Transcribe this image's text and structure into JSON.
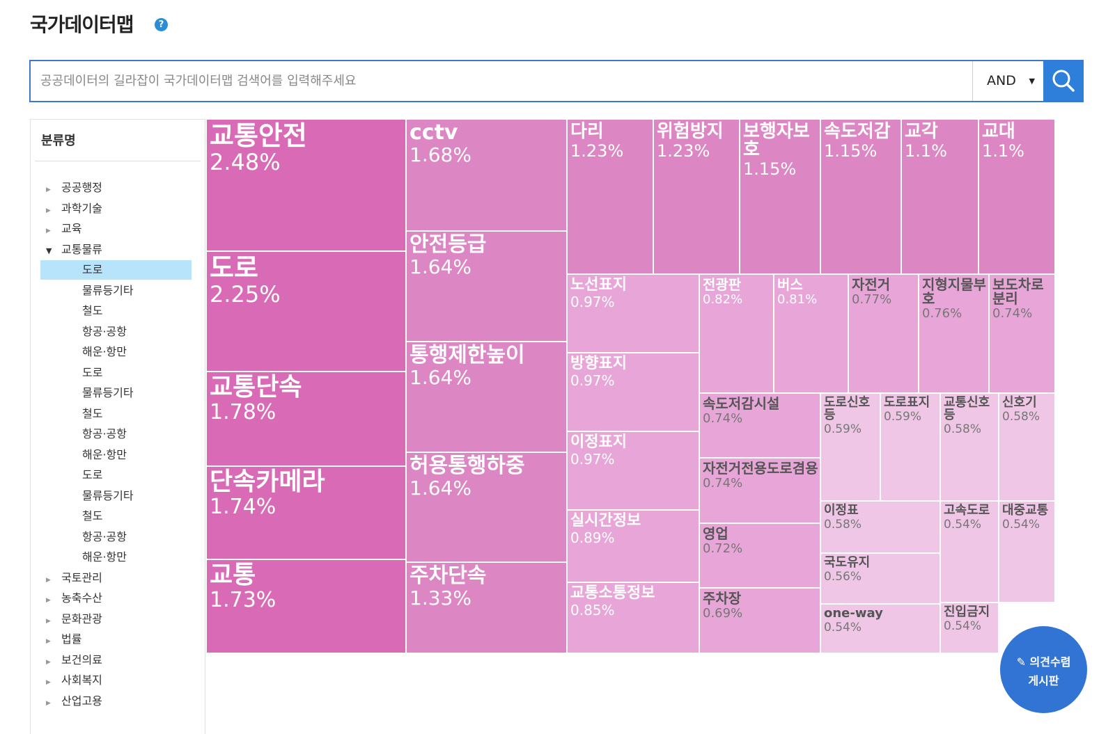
{
  "page": {
    "title": "국가데이터맵",
    "help_icon": "question-icon"
  },
  "search": {
    "placeholder": "공공데이터의 길라잡이 국가데이터맵 검색어를 입력해주세요",
    "value": "",
    "operator": "AND",
    "button_icon": "search-icon"
  },
  "sidebar": {
    "header": "분류명",
    "items": [
      {
        "label": "공공행정",
        "level": 0,
        "expanded": false,
        "selected": false
      },
      {
        "label": "과학기술",
        "level": 0,
        "expanded": false,
        "selected": false
      },
      {
        "label": "교육",
        "level": 0,
        "expanded": false,
        "selected": false
      },
      {
        "label": "교통물류",
        "level": 0,
        "expanded": true,
        "selected": false
      },
      {
        "label": "도로",
        "level": 1,
        "selected": true
      },
      {
        "label": "물류등기타",
        "level": 1,
        "selected": false
      },
      {
        "label": "철도",
        "level": 1,
        "selected": false
      },
      {
        "label": "항공·공항",
        "level": 1,
        "selected": false
      },
      {
        "label": "해운·항만",
        "level": 1,
        "selected": false
      },
      {
        "label": "도로",
        "level": 1,
        "selected": false
      },
      {
        "label": "물류등기타",
        "level": 1,
        "selected": false
      },
      {
        "label": "철도",
        "level": 1,
        "selected": false
      },
      {
        "label": "항공·공항",
        "level": 1,
        "selected": false
      },
      {
        "label": "해운·항만",
        "level": 1,
        "selected": false
      },
      {
        "label": "도로",
        "level": 1,
        "selected": false
      },
      {
        "label": "물류등기타",
        "level": 1,
        "selected": false
      },
      {
        "label": "철도",
        "level": 1,
        "selected": false
      },
      {
        "label": "항공·공항",
        "level": 1,
        "selected": false
      },
      {
        "label": "해운·항만",
        "level": 1,
        "selected": false
      },
      {
        "label": "국토관리",
        "level": 0,
        "expanded": false,
        "selected": false
      },
      {
        "label": "농축수산",
        "level": 0,
        "expanded": false,
        "selected": false
      },
      {
        "label": "문화관광",
        "level": 0,
        "expanded": false,
        "selected": false
      },
      {
        "label": "법률",
        "level": 0,
        "expanded": false,
        "selected": false
      },
      {
        "label": "보건의료",
        "level": 0,
        "expanded": false,
        "selected": false
      },
      {
        "label": "사회복지",
        "level": 0,
        "expanded": false,
        "selected": false
      },
      {
        "label": "산업고용",
        "level": 0,
        "expanded": false,
        "selected": false
      }
    ]
  },
  "chart_data": {
    "type": "treemap",
    "colors": {
      "large": "#d96bb6",
      "mid": "#dd86c4",
      "small": "#e7a6d7",
      "tiny": "#efc6e6"
    },
    "tiles": [
      {
        "name": "교통안전",
        "value": 2.48,
        "label": "2.48%"
      },
      {
        "name": "도로",
        "value": 2.25,
        "label": "2.25%"
      },
      {
        "name": "교통단속",
        "value": 1.78,
        "label": "1.78%"
      },
      {
        "name": "단속카메라",
        "value": 1.74,
        "label": "1.74%"
      },
      {
        "name": "교통",
        "value": 1.73,
        "label": "1.73%"
      },
      {
        "name": "cctv",
        "value": 1.68,
        "label": "1.68%"
      },
      {
        "name": "안전등급",
        "value": 1.64,
        "label": "1.64%"
      },
      {
        "name": "통행제한높이",
        "value": 1.64,
        "label": "1.64%"
      },
      {
        "name": "허용통행하중",
        "value": 1.64,
        "label": "1.64%"
      },
      {
        "name": "주차단속",
        "value": 1.33,
        "label": "1.33%"
      },
      {
        "name": "다리",
        "value": 1.23,
        "label": "1.23%"
      },
      {
        "name": "위험방지",
        "value": 1.23,
        "label": "1.23%"
      },
      {
        "name": "보행자보호",
        "value": 1.15,
        "label": "1.15%"
      },
      {
        "name": "속도저감",
        "value": 1.15,
        "label": "1.15%"
      },
      {
        "name": "교각",
        "value": 1.1,
        "label": "1.1%"
      },
      {
        "name": "교대",
        "value": 1.1,
        "label": "1.1%"
      },
      {
        "name": "노선표지",
        "value": 0.97,
        "label": "0.97%"
      },
      {
        "name": "방향표지",
        "value": 0.97,
        "label": "0.97%"
      },
      {
        "name": "이정표지",
        "value": 0.97,
        "label": "0.97%"
      },
      {
        "name": "실시간정보",
        "value": 0.89,
        "label": "0.89%"
      },
      {
        "name": "교통소통정보",
        "value": 0.85,
        "label": "0.85%"
      },
      {
        "name": "전광판",
        "value": 0.82,
        "label": "0.82%"
      },
      {
        "name": "버스",
        "value": 0.81,
        "label": "0.81%"
      },
      {
        "name": "자전거",
        "value": 0.77,
        "label": "0.77%"
      },
      {
        "name": "지형지물부호",
        "value": 0.76,
        "label": "0.76%"
      },
      {
        "name": "보도차로분리",
        "value": 0.74,
        "label": "0.74%"
      },
      {
        "name": "속도저감시설",
        "value": 0.74,
        "label": "0.74%"
      },
      {
        "name": "자전거전용도로겸용",
        "value": 0.74,
        "label": "0.74%"
      },
      {
        "name": "영업",
        "value": 0.72,
        "label": "0.72%"
      },
      {
        "name": "주차장",
        "value": 0.69,
        "label": "0.69%"
      },
      {
        "name": "도로신호등",
        "value": 0.59,
        "label": "0.59%"
      },
      {
        "name": "도로표지",
        "value": 0.59,
        "label": "0.59%"
      },
      {
        "name": "교통신호등",
        "value": 0.58,
        "label": "0.58%"
      },
      {
        "name": "신호기",
        "value": 0.58,
        "label": "0.58%"
      },
      {
        "name": "이정표",
        "value": 0.58,
        "label": "0.58%"
      },
      {
        "name": "국도유지",
        "value": 0.56,
        "label": "0.56%"
      },
      {
        "name": "one-way",
        "value": 0.54,
        "label": "0.54%"
      },
      {
        "name": "고속도로",
        "value": 0.54,
        "label": "0.54%"
      },
      {
        "name": "대중교통",
        "value": 0.54,
        "label": "0.54%"
      },
      {
        "name": "진입금지",
        "value": 0.54,
        "label": "0.54%"
      }
    ]
  },
  "fab": {
    "line1": "✎ 의견수렴",
    "line2": "게시판",
    "icon": "pencil-icon"
  }
}
